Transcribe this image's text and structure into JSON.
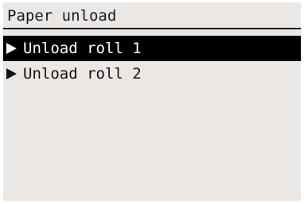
{
  "header": {
    "title": "Paper unload"
  },
  "menu": {
    "items": [
      {
        "label": "Unload roll 1",
        "selected": true,
        "icon": "arrow-right-icon"
      },
      {
        "label": "Unload roll 2",
        "selected": false,
        "icon": "arrow-right-icon"
      }
    ]
  },
  "colors": {
    "screen_background": "#ebe7e4",
    "highlight_background": "#000000",
    "text": "#111111"
  }
}
